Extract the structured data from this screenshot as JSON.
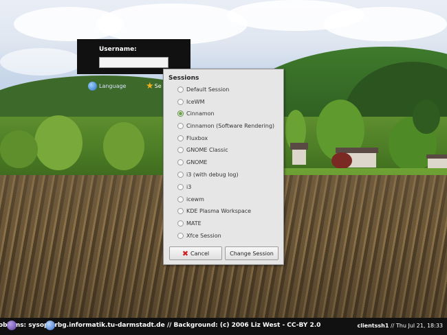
{
  "login": {
    "username_label": "Username:",
    "username_value": ""
  },
  "buttons": {
    "language_label": "Language",
    "session_label": "Se"
  },
  "sessions": {
    "title": "Sessions",
    "items": [
      {
        "label": "Default Session",
        "selected": false
      },
      {
        "label": "IceWM",
        "selected": false
      },
      {
        "label": "Cinnamon",
        "selected": true
      },
      {
        "label": "Cinnamon (Software Rendering)",
        "selected": false
      },
      {
        "label": "Fluxbox",
        "selected": false
      },
      {
        "label": "GNOME Classic",
        "selected": false
      },
      {
        "label": "GNOME",
        "selected": false
      },
      {
        "label": "i3 (with debug log)",
        "selected": false
      },
      {
        "label": "i3",
        "selected": false
      },
      {
        "label": "icewm",
        "selected": false
      },
      {
        "label": "KDE Plasma Workspace",
        "selected": false
      },
      {
        "label": "MATE",
        "selected": false
      },
      {
        "label": "Xfce Session",
        "selected": false
      }
    ],
    "cancel_label": "Cancel",
    "change_label": "Change Session"
  },
  "statusbar": {
    "left_text": "oblems: sysop@rbg.informatik.tu-darmstadt.de // Background: (c) 2006 Liz West - CC-BY 2.0",
    "hostname": "clientssh1",
    "separator": "//",
    "datetime": "Thu Jul 21, 18:33"
  },
  "colors": {
    "status_bg": "#111111",
    "popup_bg": "#e6e6e6",
    "selected_radio": "#6aa24a",
    "cancel_icon": "#d02020",
    "star_icon": "#f0b020"
  },
  "icons": {
    "language": "globe-icon",
    "session": "star-icon",
    "cancel": "cancel-x-icon"
  }
}
